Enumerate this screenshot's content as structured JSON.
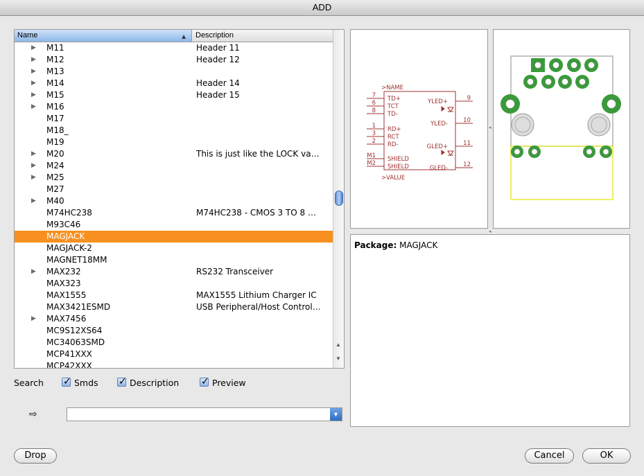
{
  "window": {
    "title": "ADD"
  },
  "list": {
    "col_name": "Name",
    "col_desc": "Description",
    "rows": [
      {
        "name": "M11",
        "desc": "Header 11",
        "expand": true
      },
      {
        "name": "M12",
        "desc": "Header 12",
        "expand": true
      },
      {
        "name": "M13",
        "desc": "",
        "expand": true
      },
      {
        "name": "M14",
        "desc": "Header 14",
        "expand": true
      },
      {
        "name": "M15",
        "desc": "Header 15",
        "expand": true
      },
      {
        "name": "M16",
        "desc": "",
        "expand": true
      },
      {
        "name": "M17",
        "desc": "",
        "expand": false
      },
      {
        "name": "M18_",
        "desc": "",
        "expand": false
      },
      {
        "name": "M19",
        "desc": "",
        "expand": false
      },
      {
        "name": "M20",
        "desc": "This is just like the LOCK va…",
        "expand": true
      },
      {
        "name": "M24",
        "desc": "",
        "expand": true
      },
      {
        "name": "M25",
        "desc": "",
        "expand": true
      },
      {
        "name": "M27",
        "desc": "",
        "expand": false
      },
      {
        "name": "M40",
        "desc": "",
        "expand": true
      },
      {
        "name": "M74HC238",
        "desc": "M74HC238 - CMOS 3 TO 8 …",
        "expand": false
      },
      {
        "name": "M93C46",
        "desc": "",
        "expand": false
      },
      {
        "name": "MAGJACK",
        "desc": "",
        "expand": false,
        "selected": true
      },
      {
        "name": "MAGJACK-2",
        "desc": "",
        "expand": false
      },
      {
        "name": "MAGNET18MM",
        "desc": "",
        "expand": false
      },
      {
        "name": "MAX232",
        "desc": "RS232 Transceiver",
        "expand": true
      },
      {
        "name": "MAX323",
        "desc": "",
        "expand": false
      },
      {
        "name": "MAX1555",
        "desc": "MAX1555 Lithium Charger IC",
        "expand": false
      },
      {
        "name": "MAX3421ESMD",
        "desc": "USB Peripheral/Host Control…",
        "expand": false
      },
      {
        "name": "MAX7456",
        "desc": "",
        "expand": true
      },
      {
        "name": "MC9S12XS64",
        "desc": "",
        "expand": false
      },
      {
        "name": "MC34063SMD",
        "desc": "",
        "expand": false
      },
      {
        "name": "MCP41XXX",
        "desc": "",
        "expand": false
      },
      {
        "name": "MCP42XXX",
        "desc": "",
        "expand": false
      }
    ]
  },
  "symbol": {
    "name_label": ">NAME",
    "value_label": ">VALUE",
    "left_pins": [
      {
        "num": "7",
        "label": "TD+"
      },
      {
        "num": "6",
        "label": "TCT"
      },
      {
        "num": "8",
        "label": "TD-"
      },
      {
        "num": "1",
        "label": "RD+"
      },
      {
        "num": "3",
        "label": "RCT"
      },
      {
        "num": "2",
        "label": "RD-"
      },
      {
        "num": "M1",
        "label": "SHIELD"
      },
      {
        "num": "M2",
        "label": "SHIELD"
      }
    ],
    "right_pins": [
      {
        "num": "9",
        "label": "YLED+"
      },
      {
        "num": "10",
        "label": "YLED-"
      },
      {
        "num": "11",
        "label": "GLED+"
      },
      {
        "num": "12",
        "label": "GLED-"
      }
    ],
    "color": "#a03030"
  },
  "info": {
    "package_label": "Package:",
    "package_value": "MAGJACK"
  },
  "search": {
    "label": "Search",
    "smds": "Smds",
    "description": "Description",
    "preview": "Preview",
    "input_value": ""
  },
  "buttons": {
    "drop": "Drop",
    "cancel": "Cancel",
    "ok": "OK"
  },
  "colors": {
    "selection": "#f8901f",
    "pad": "#3a9a3a"
  }
}
